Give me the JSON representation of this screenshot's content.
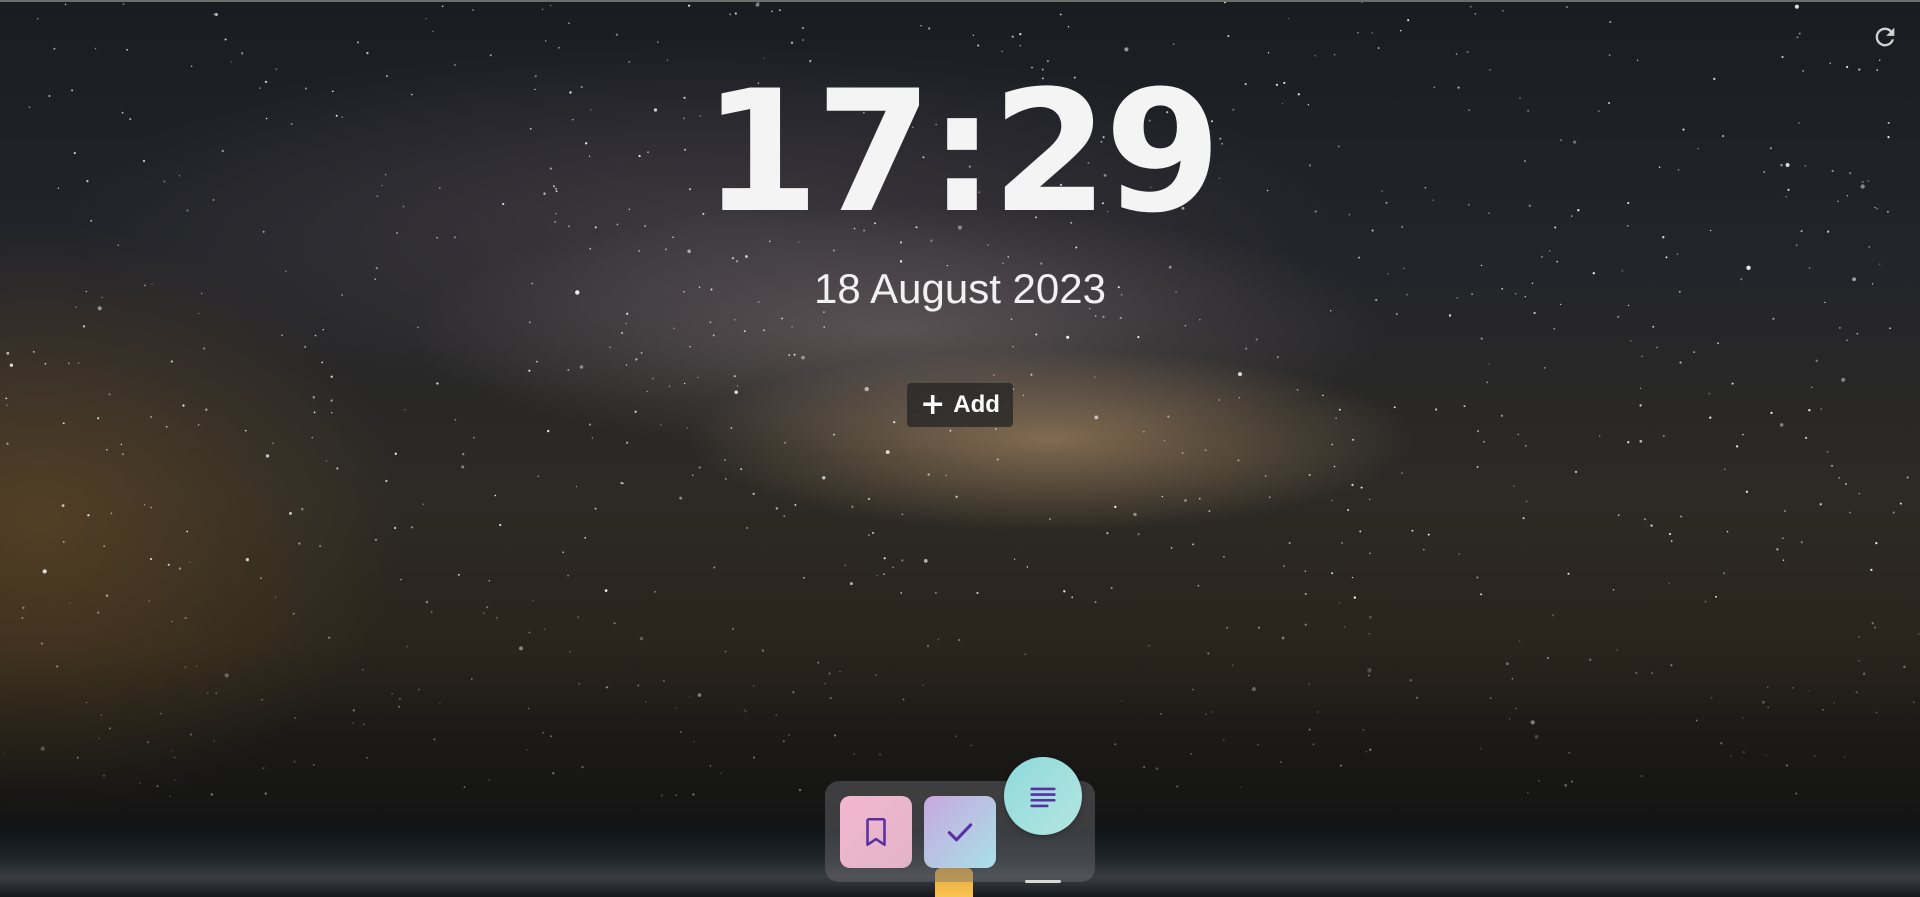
{
  "clock": {
    "time": "17:29",
    "date": "18 August 2023"
  },
  "actions": {
    "add_label": "Add",
    "add_icon": "plus-icon",
    "refresh_icon": "refresh-icon"
  },
  "dock": {
    "items": [
      {
        "icon": "bookmark-icon",
        "color_from": "#f2b7cf",
        "color_to": "#e2b4c8"
      },
      {
        "icon": "check-icon",
        "color_from": "#c7a8e0",
        "color_to": "#a9e0e6"
      },
      {
        "icon": "notes-icon",
        "color_from": "#8fdadb",
        "color_to": "#b3e5e0"
      }
    ]
  },
  "colors": {
    "icon_purple": "#5a2fa0",
    "text": "#f4f4f4"
  }
}
